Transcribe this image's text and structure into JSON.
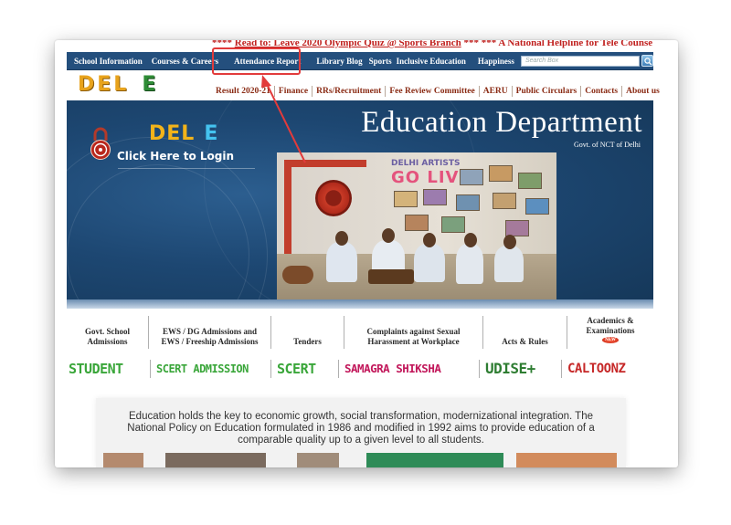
{
  "ticker": {
    "prefix": "**** ",
    "link": "Read to: Leave 2020 Olympic Quiz @ Sports Branch",
    "suffix": " *** *** A National Helpline for Tele Counse"
  },
  "topnav": {
    "items": [
      "School Information",
      "Courses & Careers",
      "Attendance Report",
      "Library Blog",
      "Sports",
      "Inclusive Education",
      "Happiness"
    ],
    "search_placeholder": "Search Box"
  },
  "logo": {
    "left": "DEL",
    "right": "E"
  },
  "secnav": {
    "items": [
      "Result 2020-21",
      "Finance",
      "RRs/Recruitment",
      "Fee Review Committee",
      "AERU",
      "Public Circulars",
      "Contacts",
      "About us"
    ]
  },
  "banner": {
    "title": "Education Department",
    "subtitle": "Govt. of NCT of  Delhi",
    "login_logo_left": "DEL",
    "login_logo_right": "E",
    "login_text": "Click Here to Login",
    "photo_sign_top": "DELHI ARTISTS",
    "photo_sign_main": "GO LIVE!"
  },
  "links": [
    {
      "line1": "Govt. School",
      "line2": "Admissions"
    },
    {
      "line1": "EWS / DG Admissions and",
      "line2": "EWS / Freeship Admissions"
    },
    {
      "line1": "",
      "line2": "Tenders"
    },
    {
      "line1": "Complaints against Sexual",
      "line2": "Harassment at Workplace"
    },
    {
      "line1": "",
      "line2": "Acts & Rules"
    },
    {
      "line1": "Academics &",
      "line2": "Examinations",
      "badge": "NEW"
    }
  ],
  "partners": [
    {
      "label": "STUDENT",
      "color": "#3aa63a"
    },
    {
      "label": "SCERT ADMISSION",
      "color": "#3aa63a"
    },
    {
      "label": "SCERT",
      "color": "#3aa63a"
    },
    {
      "label": "SAMAGRA SHIKSHA",
      "color": "#c2185b"
    },
    {
      "label": "UDISE+",
      "color": "#2e7d32"
    },
    {
      "label": "CALTOONZ",
      "color": "#c62828"
    }
  ],
  "intro": {
    "text": "Education holds the key to economic growth, social transformation, modernizational integration. The National Policy on Education formulated in 1986 and modified in 1992 aims to provide education of a comparable quality up to a given level to all students."
  },
  "colors": {
    "nav_bg": "#244f7d",
    "banner_bg": "#1d4772",
    "highlight": "#e23b3b",
    "secnav_text": "#8a2b14",
    "ticker_text": "#c0201e"
  }
}
